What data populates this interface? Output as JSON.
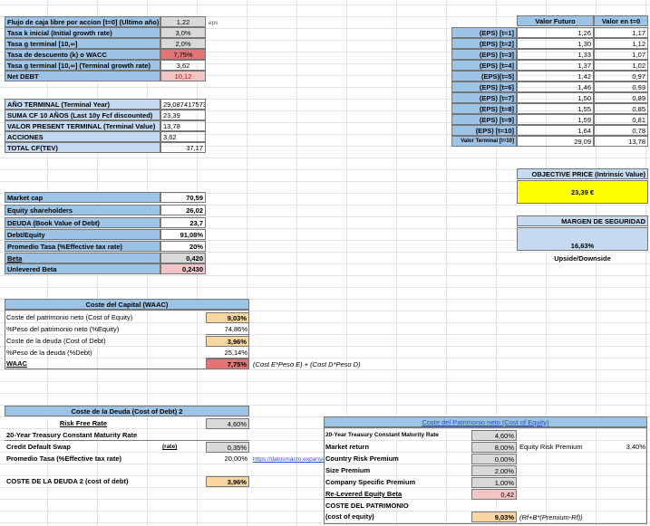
{
  "top_block": {
    "rows": [
      {
        "label": "Flujo de caja libre por accion [t=0] (Ultimo año)",
        "value": "1,22",
        "unit": "eps"
      },
      {
        "label": "Tasa k inicial (Initial growth rate)",
        "value": "3,0%"
      },
      {
        "label": "Tasa g terminal [10,∞]",
        "value": "2,0%"
      },
      {
        "label": "Tasa de descuento (k) o WACC",
        "value": "7,75%"
      },
      {
        "label": "Tasa g terminal [10,∞] (Terminal growth rate)",
        "value": "3,62"
      },
      {
        "label": "Net DEBT",
        "value": "10,12"
      }
    ]
  },
  "terminal_block": {
    "rows": [
      {
        "label": "AÑO TERMINAL (Terminal Year)",
        "value": "29,087417573"
      },
      {
        "label": "SUMA CF 10 AÑOS (Last 10y Fcf discounted)",
        "value": "23,39"
      },
      {
        "label": "VALOR PRESENT TERMINAL (Terminal Value)",
        "value": "13,78"
      },
      {
        "label": "ACCIONES",
        "value": "3,62"
      },
      {
        "label": "TOTAL CF(TEV)",
        "value": "37,17"
      }
    ]
  },
  "eps_table": {
    "header_future": "Valor Futuro",
    "header_t0": "Valor en t=0",
    "rows": [
      {
        "label": "(EPS) [t=1]",
        "future": "1,26",
        "t0": "1,17"
      },
      {
        "label": "(EPS) [t=2]",
        "future": "1,30",
        "t0": "1,12"
      },
      {
        "label": "(EPS) [t=3]",
        "future": "1,33",
        "t0": "1,07"
      },
      {
        "label": "(EPS) [t=4]",
        "future": "1,37",
        "t0": "1,02"
      },
      {
        "label": "(EPS)[t=5]",
        "future": "1,42",
        "t0": "0,97"
      },
      {
        "label": "(EPS) [t=6]",
        "future": "1,46",
        "t0": "0,93"
      },
      {
        "label": "(EPS) [t=7]",
        "future": "1,50",
        "t0": "0,89"
      },
      {
        "label": "(EPS) [t=8]",
        "future": "1,55",
        "t0": "0,85"
      },
      {
        "label": "(EPS) [t=9]",
        "future": "1,59",
        "t0": "0,81"
      },
      {
        "label": "(EPS) [t=10]",
        "future": "1,64",
        "t0": "0,78"
      },
      {
        "label": "Valor Terminal [t=10]",
        "future": "29,09",
        "t0": "13,78"
      }
    ]
  },
  "objective": {
    "label": "OBJECTIVE PRICE (Intrinsic Value)",
    "value": "23,39 €"
  },
  "margin": {
    "label": "MARGEN DE SEGURIDAD",
    "value": "16,63%",
    "note": "Upside/Downside"
  },
  "market_block": {
    "rows": [
      {
        "label": "Market cap",
        "value": "70,59"
      },
      {
        "label": "Equity shareholders",
        "value": "26,02"
      },
      {
        "label": "DEUDA (Book Value of Debt)",
        "value": "23,7"
      },
      {
        "label": "Debt/Equity",
        "value": "91,08%"
      },
      {
        "label": "Promedio Tasa (%Effective tax rate)",
        "value": "20%"
      },
      {
        "label": "Beta",
        "value": "0,420"
      },
      {
        "label": "Unlevered Beta",
        "value": "0,2430"
      }
    ]
  },
  "wacc_block": {
    "title": "Coste del Capital (WAAC)",
    "rows": [
      {
        "label": "Coste del patrimonio neto (Cost of Equity)",
        "value": "9,03%"
      },
      {
        "label": "%Peso del patrimonio neto (%Equity)",
        "value": "74,86%"
      },
      {
        "label": "Coste de la deuda (Cost of Debt)",
        "value": "3,96%"
      },
      {
        "label": "%Peso de la deuda (%Debt)",
        "value": "25,14%"
      },
      {
        "label": "WAAC",
        "value": "7,75%",
        "formula": "(Cost E*Peso E) + (Cost D*Peso D)"
      }
    ]
  },
  "debt_block": {
    "title": "Coste de la Deuda (Cost of Debt) 2",
    "risk_free_label": "Risk Free Rate",
    "risk_free_value": "4,60%",
    "treasury_label": "20-Year Treasury Constant Maturity Rate",
    "cds_label": "Credit Default Swap",
    "cds_note": "(rate)",
    "cds_value": "0,35%",
    "tax_label": "Promedio Tasa (%Effective tax rate)",
    "tax_value": "20,00%",
    "tax_link": "https://datosmacro.expansion.com",
    "cost_label": "COSTE DE LA DEUDA 2 (cost of debt)",
    "cost_value": "3,96%"
  },
  "equity_block": {
    "title": "Coste del Patrimonio neto (Cost of Equity)",
    "rows": [
      {
        "label": "20-Year Treasury Constant Maturity Rate",
        "value": "4,60%"
      },
      {
        "label": "Market return",
        "value": "8,00%"
      },
      {
        "label": "Country Risk Premium",
        "value": "0,00%"
      },
      {
        "label": "Size Premium",
        "value": "2,00%"
      },
      {
        "label": "Company Specific Premium",
        "value": "1,00%"
      },
      {
        "label": "Re-Levered Equity Beta",
        "value": "0,42"
      }
    ],
    "erp_label": "Equity Risk Premium",
    "erp_value": "3,40%",
    "final_label_1": "COSTE DEL PATRIMONIO",
    "final_label_2": "(cost of equity)",
    "final_value": "9,03%",
    "final_formula": "(Rf+B*(Premium-Rf))"
  }
}
